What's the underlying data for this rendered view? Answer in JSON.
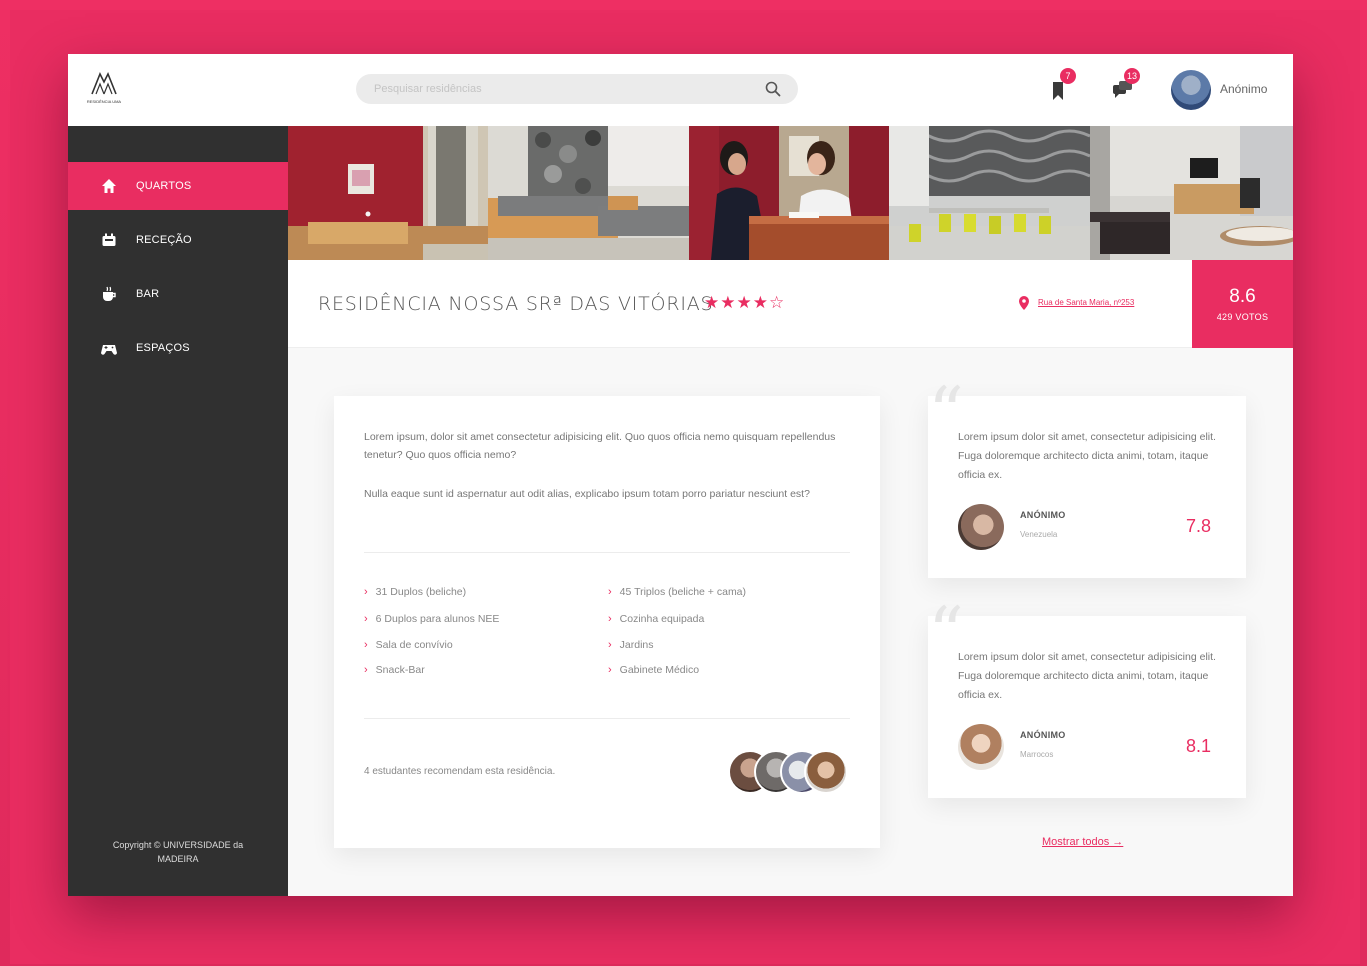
{
  "header": {
    "logo_text": "RESIDÊNCIA UMA",
    "search_placeholder": "Pesquisar residências",
    "bookmark_count": "7",
    "messages_count": "13",
    "user_name": "Anónimo"
  },
  "sidebar": {
    "items": [
      {
        "label": "QUARTOS",
        "icon": "home-icon",
        "active": true
      },
      {
        "label": "RECEÇÃO",
        "icon": "reception-icon",
        "active": false
      },
      {
        "label": "BAR",
        "icon": "coffee-icon",
        "active": false
      },
      {
        "label": "ESPAÇOS",
        "icon": "gamepad-icon",
        "active": false
      }
    ],
    "copyright_line1": "Copyright © UNIVERSIDADE da",
    "copyright_line2": "MADEIRA"
  },
  "residence": {
    "title": "RESIDÊNCIA NOSSA SRª DAS VITÓRIAS",
    "stars": "★★★★☆",
    "rating_stars": 4,
    "address": "Rua de Santa Maria, nº253",
    "score": "8.6",
    "votes": "429 VOTOS"
  },
  "description": {
    "paragraph1": "Lorem ipsum, dolor sit amet consectetur adipisicing elit. Quo quos officia nemo quisquam repellendus tenetur? Quo quos officia nemo?",
    "paragraph2": "Nulla eaque sunt id aspernatur aut odit alias, explicabo ipsum totam porro pariatur nesciunt est?",
    "features_left": [
      "31 Duplos (beliche)",
      "6 Duplos para alunos NEE",
      "Sala de convívio",
      "Snack-Bar"
    ],
    "features_right": [
      "45 Triplos (beliche + cama)",
      "Cozinha equipada",
      "Jardins",
      "Gabinete Médico"
    ],
    "recommend_text": "4 estudantes recomendam esta residência."
  },
  "reviews": [
    {
      "text": "Lorem ipsum dolor sit amet, consectetur adipisicing elit. Fuga doloremque architecto dicta animi, totam, itaque officia ex.",
      "name": "ANÓNIMO",
      "country": "Venezuela",
      "score": "7.8"
    },
    {
      "text": "Lorem ipsum dolor sit amet, consectetur adipisicing elit. Fuga doloremque architecto dicta animi, totam, itaque officia ex.",
      "name": "ANÓNIMO",
      "country": "Marrocos",
      "score": "8.1"
    }
  ],
  "show_all": "Mostrar todos →",
  "colors": {
    "accent": "#e92d61",
    "sidebar": "#303030",
    "background": "#f8f8f8"
  }
}
